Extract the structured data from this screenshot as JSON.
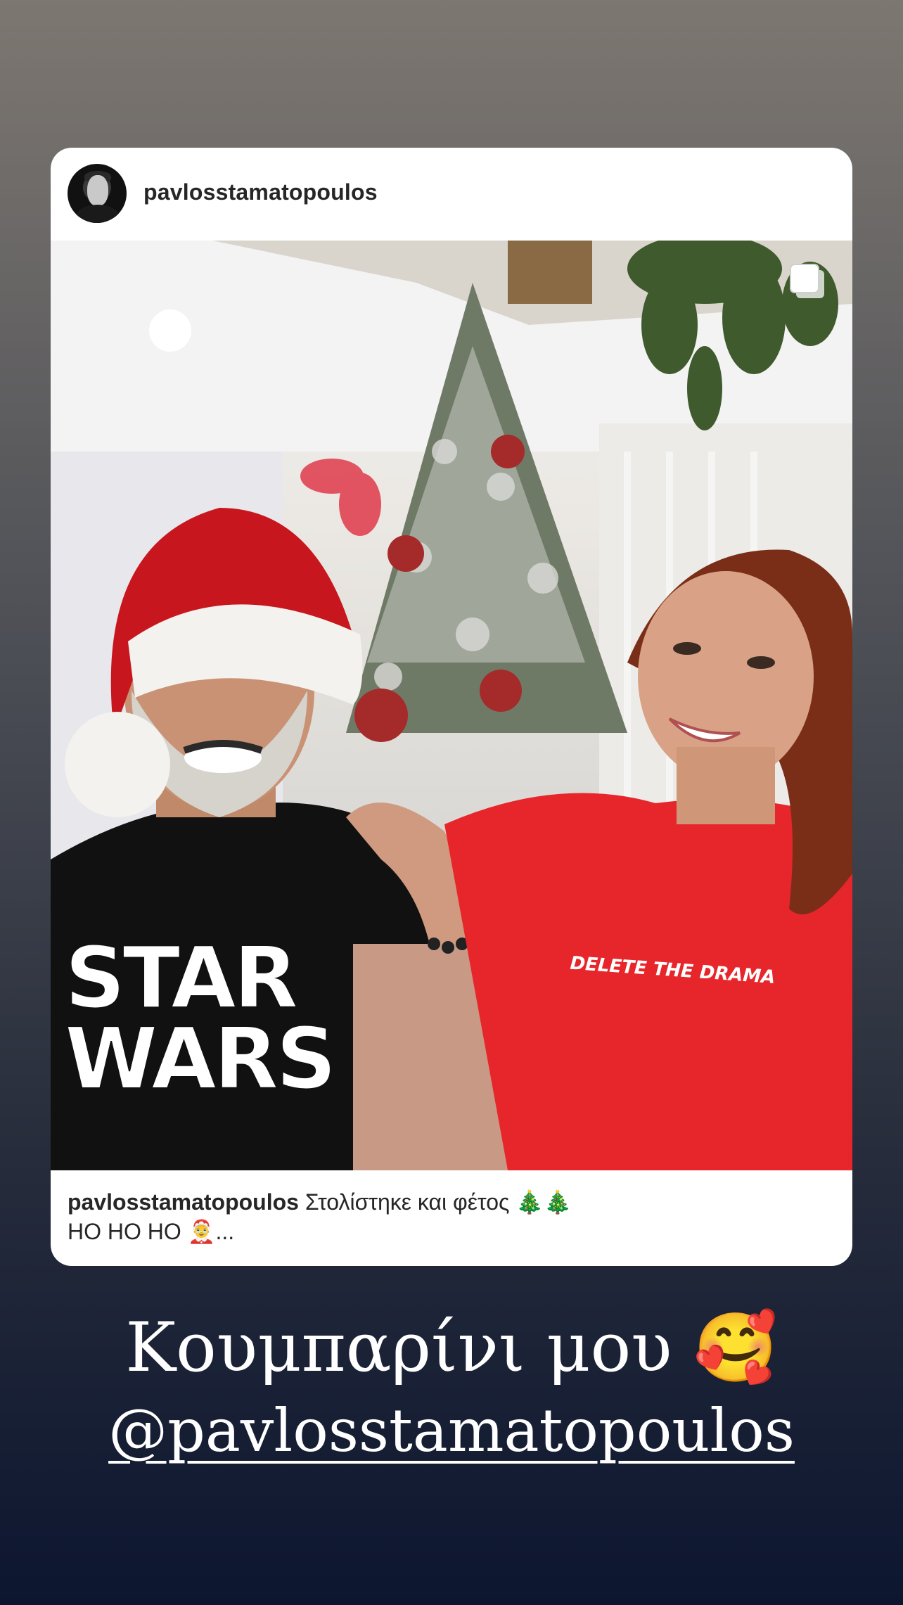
{
  "post": {
    "username": "pavlosstamatopoulos",
    "caption_user": "pavlosstamatopoulos",
    "caption_line1": "Στολίστηκε και φέτος 🎄🎄",
    "caption_line2": "HO HO HO 🤶...",
    "multi_photo_icon": "carousel-icon",
    "photo_shirt_left": "STAR WARS",
    "photo_shirt_right": "DELETE THE DRAMA"
  },
  "story": {
    "text_line1": "Κουμπαρίνι μου 🥰",
    "mention": "@pavlosstamatopoulos"
  },
  "colors": {
    "card_bg": "#ffffff",
    "text_dark": "#262626",
    "story_text": "#ffffff",
    "bg_top": "#7d7771",
    "bg_bottom": "#0d1630"
  }
}
